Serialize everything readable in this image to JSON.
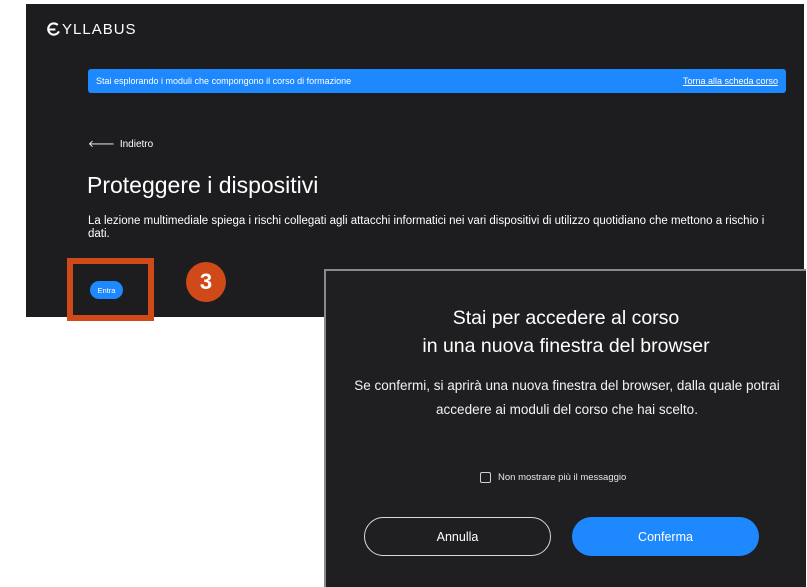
{
  "header": {
    "logo_text": "YLLABUS"
  },
  "banner": {
    "text": "Stai esplorando i moduli che compongono il corso di formazione",
    "link": "Torna alla scheda corso"
  },
  "back": {
    "label": "Indietro"
  },
  "page": {
    "title": "Proteggere i dispositivi",
    "description": "La lezione multimediale spiega i rischi collegati agli attacchi informatici nei vari dispositivi di utilizzo quotidiano che mettono a rischio i dati."
  },
  "enter_button": {
    "label": "Entra"
  },
  "step_badge": {
    "number": "3"
  },
  "modal": {
    "title_line1": "Stai per accedere al corso",
    "title_line2": "in una nuova finestra del browser",
    "body": "Se confermi, si aprirà una nuova finestra del browser, dalla quale potrai accedere ai moduli del corso che hai scelto.",
    "checkbox_label": "Non mostrare più il messaggio",
    "cancel_label": "Annulla",
    "confirm_label": "Conferma"
  },
  "colors": {
    "background_dark": "#1d1d1f",
    "accent_blue": "#1e88ff",
    "highlight_orange": "#d04a19"
  },
  "icons": {
    "logo": "syllabus-logo-icon",
    "back": "arrow-left-icon",
    "checkbox": "checkbox-unchecked-icon"
  }
}
